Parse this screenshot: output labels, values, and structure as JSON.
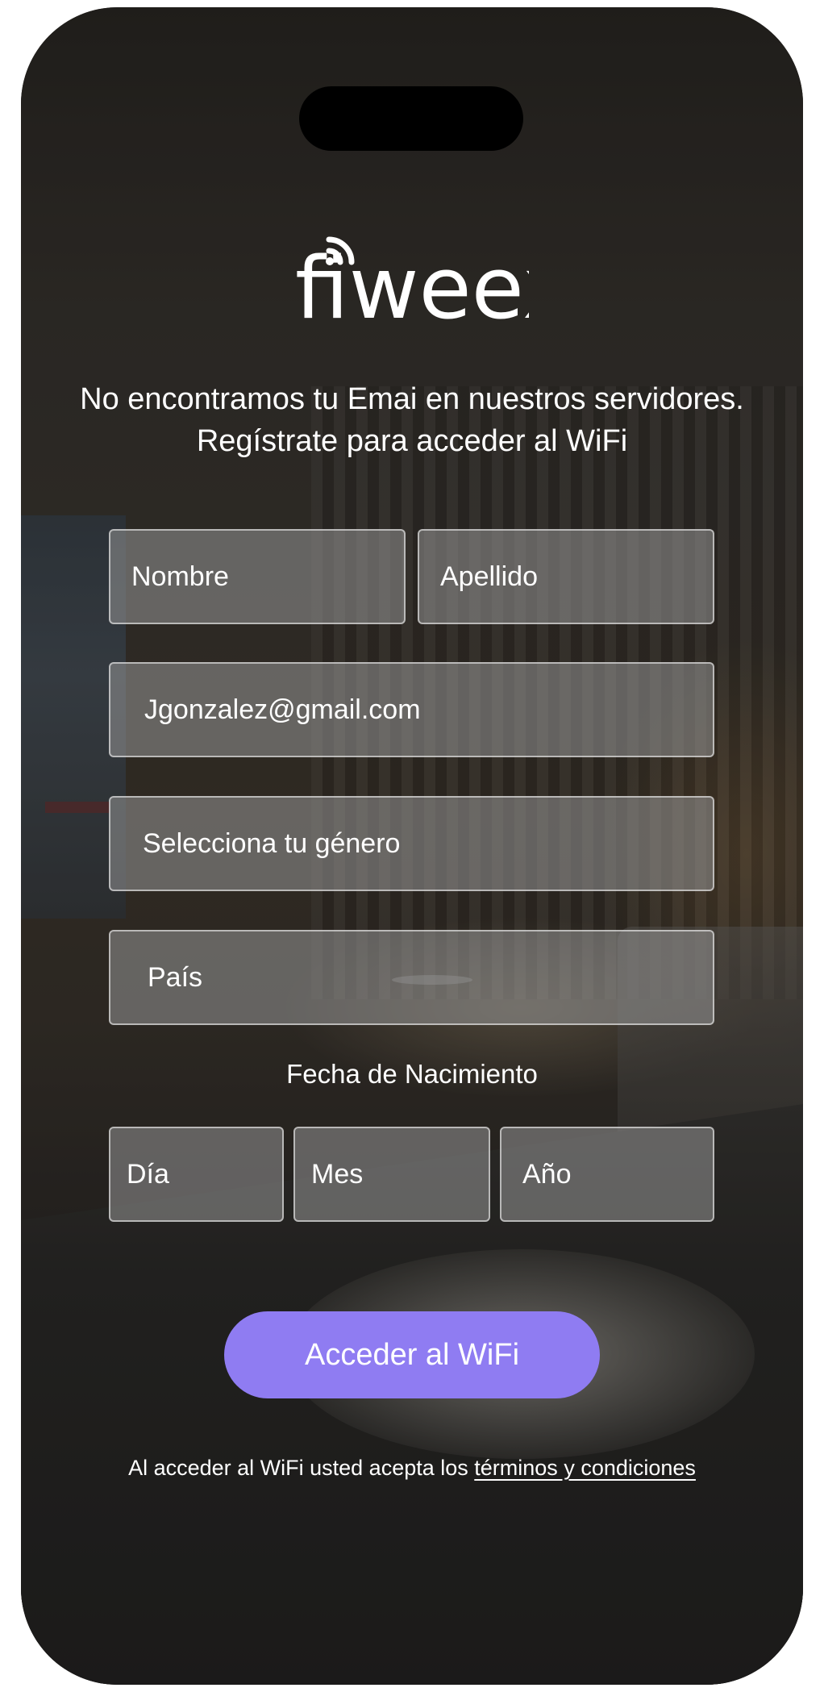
{
  "brand": {
    "logo_text": "fiweex"
  },
  "message": {
    "line1": "No encontramos tu Emai en nuestros servidores.",
    "line2": "Regístrate para acceder al WiFi"
  },
  "form": {
    "first_name_placeholder": "Nombre",
    "last_name_placeholder": "Apellido",
    "email_value": "Jgonzalez@gmail.com",
    "gender_placeholder": "Selecciona tu género",
    "country_placeholder": "País",
    "dob_label": "Fecha de Nacimiento",
    "day_placeholder": "Día",
    "month_placeholder": "Mes",
    "year_placeholder": "Año"
  },
  "actions": {
    "submit_label": "Acceder al WiFi"
  },
  "terms": {
    "prefix": "Al acceder al WiFi usted acepta los ",
    "link_text": "términos y condiciones"
  },
  "colors": {
    "accent": "#8f7cf2"
  },
  "icons": {
    "logo": "wifi-signal-icon"
  }
}
